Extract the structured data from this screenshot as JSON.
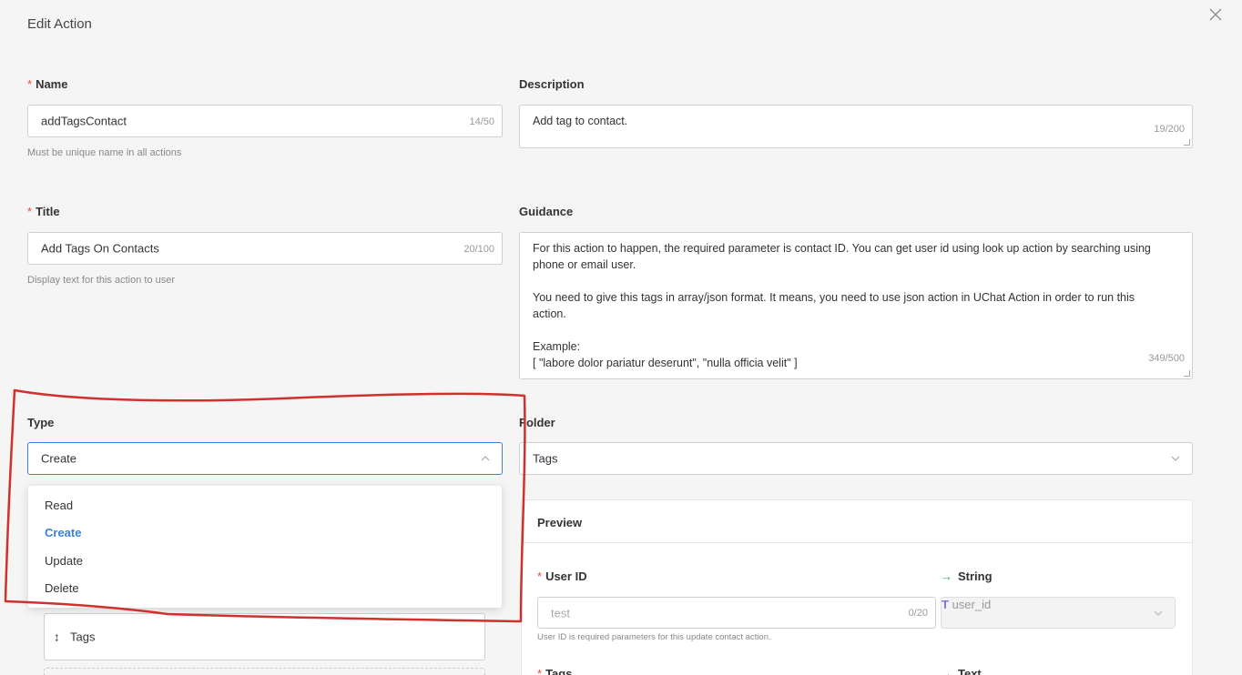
{
  "modal": {
    "title": "Edit Action"
  },
  "name": {
    "label": "Name",
    "value": "addTagsContact",
    "counter": "14/50",
    "hint": "Must be unique name in all actions"
  },
  "description": {
    "label": "Description",
    "value": "Add tag to contact.",
    "counter": "19/200"
  },
  "title": {
    "label": "Title",
    "value": "Add Tags On Contacts",
    "counter": "20/100",
    "hint": "Display text for this action to user"
  },
  "guidance": {
    "label": "Guidance",
    "value": "For this action to happen, the required parameter is contact ID. You can get user id using look up action by searching using phone or email user.\n\nYou need to give this tags in array/json format. It means, you need to use json action in UChat Action in order to run this action.\n\nExample:\n[ \"labore dolor pariatur deserunt\", \"nulla officia velit\" ]",
    "counter": "349/500"
  },
  "type": {
    "label": "Type",
    "value": "Create",
    "options": [
      "Read",
      "Create",
      "Update",
      "Delete"
    ],
    "selected_index": 1
  },
  "folder": {
    "label": "Folder",
    "value": "Tags"
  },
  "tags_param": {
    "value": "Tags"
  },
  "preview": {
    "heading": "Preview",
    "user_id": {
      "label": "User ID",
      "type": "String",
      "placeholder": "test",
      "counter": "0/20",
      "variable": "user_id",
      "hint": "User ID is required parameters for this update contact action."
    },
    "tags": {
      "label": "Tags",
      "type": "Text"
    }
  },
  "colors": {
    "accent": "#3b82d6",
    "required": "#e64c3c",
    "green": "#2fa84f",
    "annotation": "#d0312d"
  }
}
